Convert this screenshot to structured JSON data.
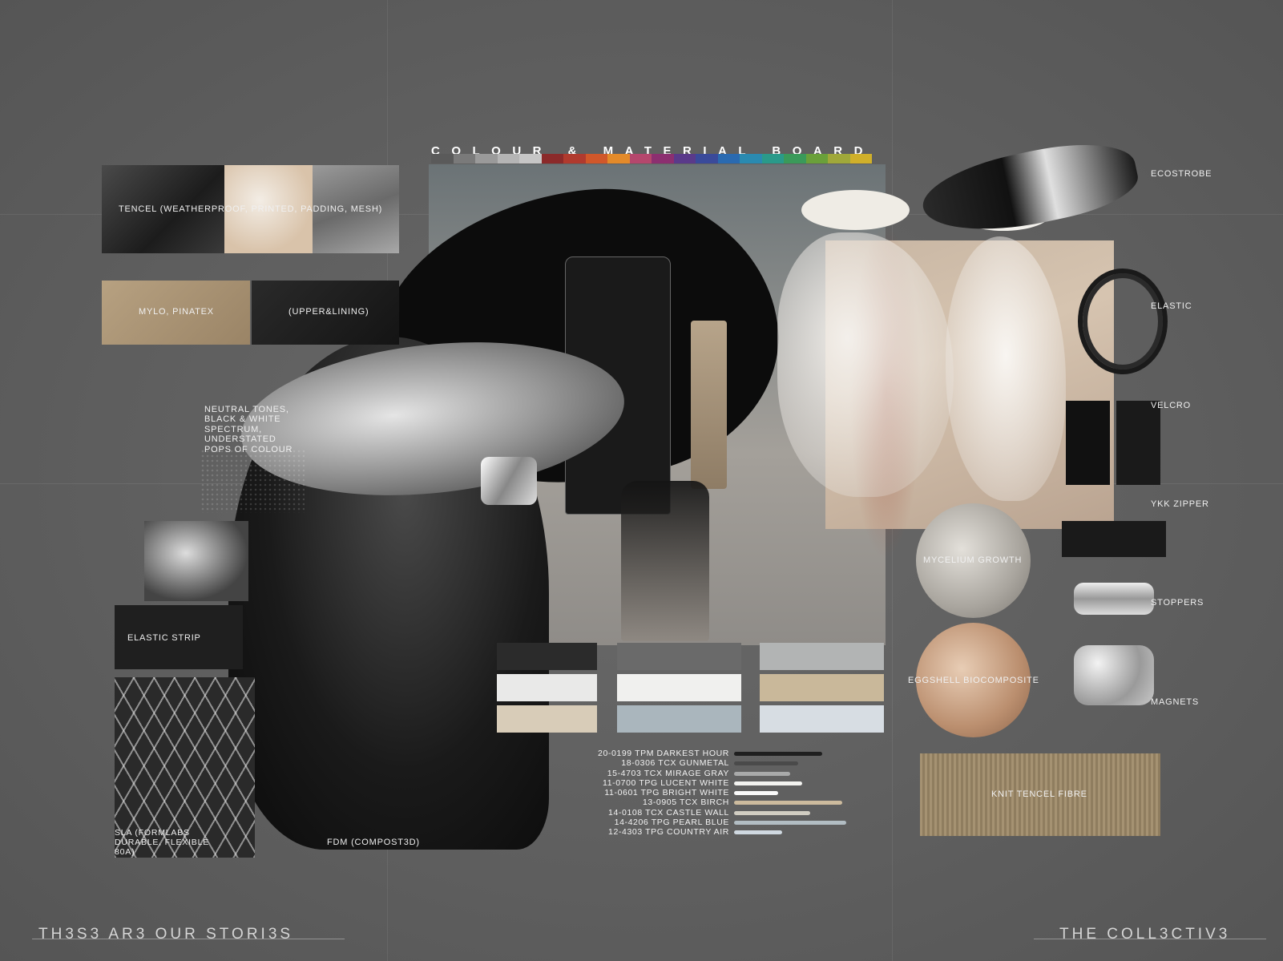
{
  "title": "COLOUR & MATERIAL BOARD",
  "spectrum_colors": [
    "#5a5a5a",
    "#7a7a7a",
    "#9a9a9a",
    "#b5b5b5",
    "#c6c6c6",
    "#8b2a2a",
    "#b03a2e",
    "#d0572a",
    "#e38a2a",
    "#b5476d",
    "#8c2f70",
    "#5a3a8a",
    "#3a4a9a",
    "#2a6ab0",
    "#2a8ab0",
    "#2a9a8a",
    "#3a9a5a",
    "#6aa03a",
    "#a0a83a",
    "#d0b02a"
  ],
  "materials_left": {
    "tencel": "TENCEL (WEATHERPROOF, PRINTED, PADDING, MESH)",
    "mylo": "MYLO, PINATEX",
    "upper_lining": "(UPPER&LINING)",
    "neutral": [
      "NEUTRAL TONES,",
      "BLACK & WHITE",
      "SPECTRUM,",
      "UNDERSTATED",
      "POPS OF COLOUR"
    ],
    "elastic_strip": "ELASTIC STRIP",
    "sla": [
      "SLA (FORMLABS",
      "DURABLE, FLEXIBLE",
      "80A)"
    ],
    "fdm": "FDM (COMPOST3D)"
  },
  "materials_right": {
    "ecostrobe": "ECOSTROBE",
    "elastic": "ELASTIC",
    "velcro": "VELCRO",
    "ykk_zipper": "YKK ZIPPER",
    "stoppers": "STOPPERS",
    "magnets": "MAGNETS",
    "mycelium": "MYCELIUM GROWTH",
    "eggshell": "EGGSHELL BIOCOMPOSITE",
    "knit_tencel": "KNIT TENCEL FIBRE"
  },
  "palette_blocks": [
    [
      "#2b2b2b",
      "#6a6a6a",
      "#b2b4b4"
    ],
    [
      "#e9e9e8",
      "#f0f0ee",
      "#c9b89a"
    ],
    [
      "#d8ccb8",
      "#aab6bd",
      "#d7dde3"
    ]
  ],
  "pantone": [
    {
      "code": "20-0199 TPM DARKEST HOUR",
      "color": "#1f1f1f",
      "w": 110
    },
    {
      "code": "18-0306 TCX GUNMETAL",
      "color": "#4a4a4a",
      "w": 80
    },
    {
      "code": "15-4703 TCX MIRAGE GRAY",
      "color": "#a9aaaa",
      "w": 70
    },
    {
      "code": "11-0700 TPG LUCENT WHITE",
      "color": "#f3f3f0",
      "w": 85
    },
    {
      "code": "11-0601 TPG BRIGHT WHITE",
      "color": "#fafafa",
      "w": 55
    },
    {
      "code": "13-0905 TCX BIRCH",
      "color": "#cdbb9e",
      "w": 135
    },
    {
      "code": "14-0108 TCX CASTLE WALL",
      "color": "#d1cdc2",
      "w": 95
    },
    {
      "code": "14-4206 TPG PEARL BLUE",
      "color": "#b2bdc3",
      "w": 140
    },
    {
      "code": "12-4303 TPG COUNTRY AIR",
      "color": "#cfd8e0",
      "w": 60
    }
  ],
  "footer": {
    "left": "TH3S3 AR3 OUR STORI3S",
    "right": "THE COLL3CTIV3"
  }
}
